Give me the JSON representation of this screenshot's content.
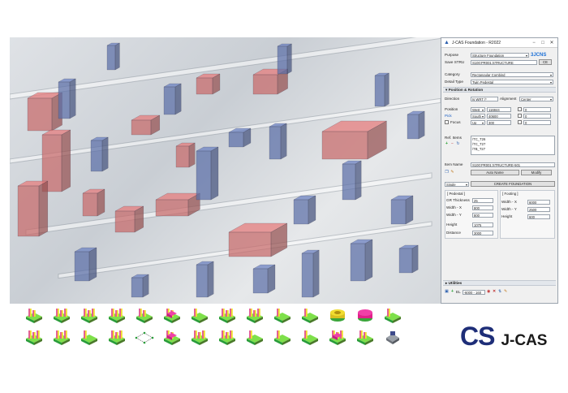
{
  "window": {
    "title": "J-CAS Foundation - R2022"
  },
  "header": {
    "purpose_label": "Purpose",
    "purpose_value": "Structure Foundation",
    "brand_badge": "3JCNS",
    "save_label": "Save STRU",
    "save_value": "S100:PR001:STRUCTURE",
    "ce_button": "CE",
    "category_label": "Category",
    "category_value": "Rectangular Combind",
    "detail_label": "Detail Type",
    "detail_value": "Twin Pedestal"
  },
  "position_section": {
    "title": "Position & Rotation",
    "direction_label": "Direction",
    "direction_value": "Is WRT /*",
    "alignment_label": "Alignment",
    "alignment_value": "Center",
    "position_label": "Position",
    "pick_label": "Pick",
    "focus_label": "Focus",
    "rows": [
      {
        "axis": "West",
        "value": "116844",
        "rot": "0"
      },
      {
        "axis": "South",
        "value": "40600",
        "rot": "0"
      },
      {
        "axis": "Up",
        "value": "300",
        "rot": "0"
      }
    ]
  },
  "ref_items": {
    "label": "Ref. Items",
    "items": [
      "/TC_T26",
      "/TC_T27",
      "/TB_T27"
    ]
  },
  "item": {
    "label": "Item Name",
    "value": "S100:PR001:STRUCTURE-501",
    "auto_button": "Auto Name",
    "modify_button": "Modify"
  },
  "create": {
    "mode_value": "Single",
    "create_button": "CREATE FOUNDATION"
  },
  "pedestal": {
    "title": "[ Pedestal ]",
    "fields": [
      {
        "label": "GR Thickness",
        "value": "25"
      },
      {
        "label": "Width - X",
        "value": "800"
      },
      {
        "label": "Width - Y",
        "value": "800"
      },
      {
        "label": "Height",
        "value": "1075"
      },
      {
        "label": "Distance",
        "value": "3000"
      }
    ]
  },
  "footing": {
    "title": "[ Footing ]",
    "fields": [
      {
        "label": "Width - X",
        "value": "6000"
      },
      {
        "label": "Width - Y",
        "value": "2500"
      },
      {
        "label": "Height",
        "value": "600"
      }
    ]
  },
  "utilities": {
    "title": "Utilities",
    "el_label": "EL",
    "el_value": "-6000 - 160"
  },
  "brand": {
    "logo": "CS",
    "name": "J-CAS"
  },
  "icons": {
    "minimize": "−",
    "maximize": "□",
    "close": "✕",
    "expand": "▸"
  },
  "colors": {
    "accent": "#1e2e78",
    "pedestal_red": "#c86a6a",
    "footing_blue": "#5c6fa8"
  }
}
